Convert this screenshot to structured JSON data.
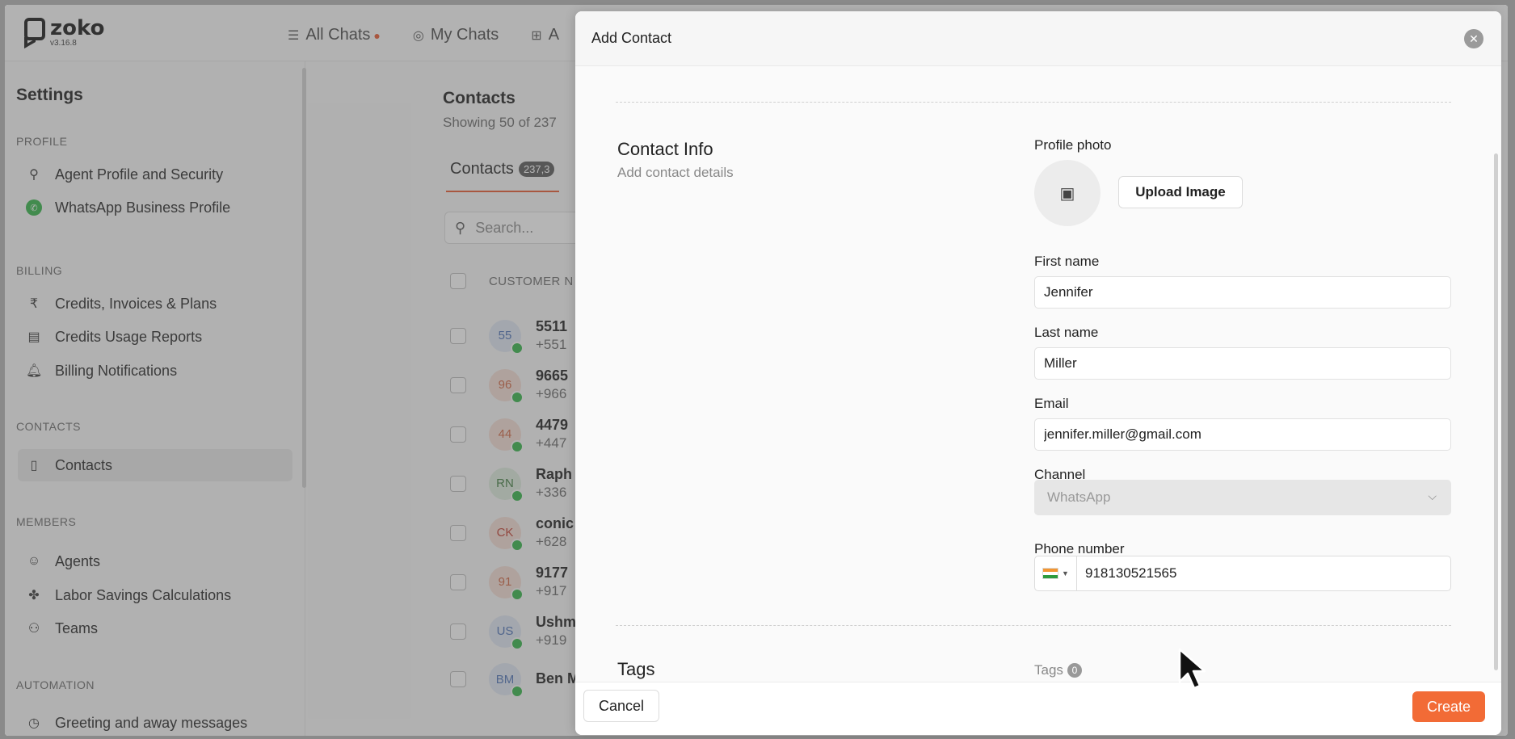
{
  "app": {
    "logo_name": "zoko",
    "version": "v3.16.8",
    "nav": [
      {
        "label": "All Chats"
      },
      {
        "label": "My Chats"
      },
      {
        "label": "A"
      }
    ]
  },
  "sidebar": {
    "title": "Settings",
    "sections": {
      "profile": "PROFILE",
      "billing": "BILLING",
      "contacts": "CONTACTS",
      "members": "MEMBERS",
      "automation": "AUTOMATION"
    },
    "items": [
      {
        "label": "Agent Profile and Security",
        "icon": "user-icon"
      },
      {
        "label": "WhatsApp Business Profile",
        "icon": "whatsapp-icon"
      },
      {
        "label": "Credits, Invoices & Plans",
        "icon": "rupee-icon"
      },
      {
        "label": "Credits Usage Reports",
        "icon": "report-icon"
      },
      {
        "label": "Billing Notifications",
        "icon": "bell-icon"
      },
      {
        "label": "Contacts",
        "icon": "book-icon"
      },
      {
        "label": "Agents",
        "icon": "agent-icon"
      },
      {
        "label": "Labor Savings Calculations",
        "icon": "puzzle-icon"
      },
      {
        "label": "Teams",
        "icon": "team-icon"
      },
      {
        "label": "Greeting and away messages",
        "icon": "clock-icon"
      }
    ]
  },
  "contacts": {
    "title": "Contacts",
    "subtitle": "Showing 50 of 237",
    "tab_label": "Contacts",
    "tab_count": "237,3",
    "search_placeholder": "Search...",
    "column_customer": "CUSTOMER N",
    "rows": [
      {
        "initials": "55",
        "name": "5511",
        "phone": "+551",
        "bg": "#dfe6f3",
        "fg": "#4a6fb5"
      },
      {
        "initials": "96",
        "name": "9665",
        "phone": "+966",
        "bg": "#f5ddd4",
        "fg": "#d0633e"
      },
      {
        "initials": "44",
        "name": "4479",
        "phone": "+447",
        "bg": "#f5ddd4",
        "fg": "#d0633e"
      },
      {
        "initials": "RN",
        "name": "Raph",
        "phone": "+336",
        "bg": "#dcebdc",
        "fg": "#3c7a3c"
      },
      {
        "initials": "CK",
        "name": "conic",
        "phone": "+628",
        "bg": "#f5ddd4",
        "fg": "#c0392b"
      },
      {
        "initials": "91",
        "name": "9177",
        "phone": "+917",
        "bg": "#f5ddd4",
        "fg": "#d0633e"
      },
      {
        "initials": "US",
        "name": "Ushm",
        "phone": "+919",
        "bg": "#dfe6f3",
        "fg": "#4a6fb5"
      },
      {
        "initials": "BM",
        "name": "Ben Michaels",
        "phone": "",
        "bg": "#dfe6f3",
        "fg": "#4a6fb5"
      }
    ]
  },
  "modal": {
    "title": "Add Contact",
    "contact_info_title": "Contact Info",
    "contact_info_sub": "Add contact details",
    "profile_photo_label": "Profile photo",
    "upload_label": "Upload Image",
    "first_name_label": "First name",
    "first_name_value": "Jennifer",
    "last_name_label": "Last name",
    "last_name_value": "Miller",
    "email_label": "Email",
    "email_value": "jennifer.miller@gmail.com",
    "channel_label": "Channel",
    "channel_value": "WhatsApp",
    "phone_label": "Phone number",
    "phone_value": "918130521565",
    "tags_title": "Tags",
    "tags_label": "Tags",
    "tags_count": "0",
    "cancel_label": "Cancel",
    "create_label": "Create"
  },
  "colors": {
    "accent": "#f26b36",
    "whatsapp": "#2fb344"
  }
}
